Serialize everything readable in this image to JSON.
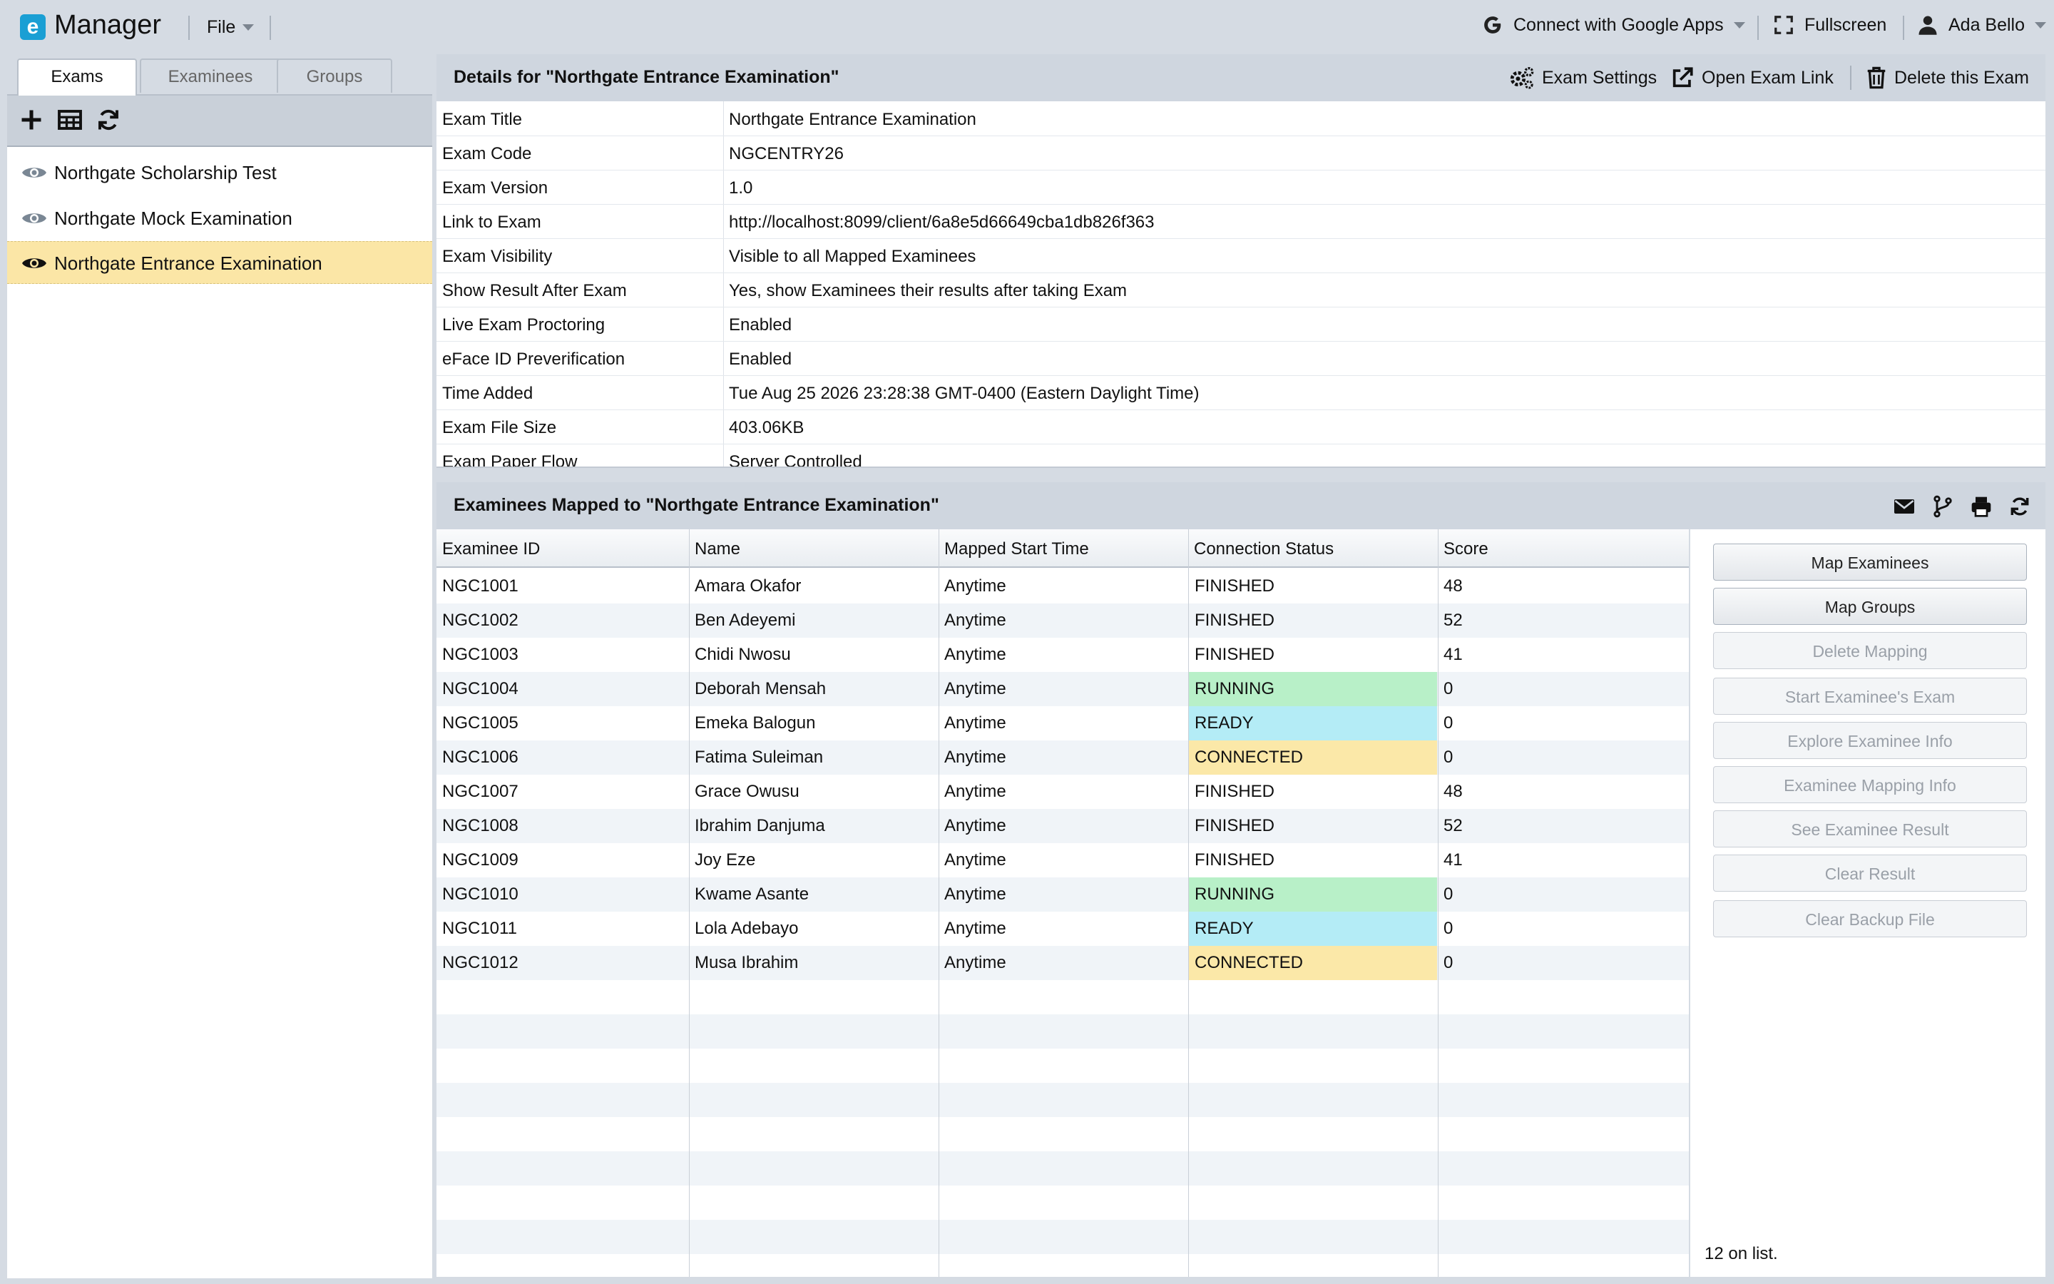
{
  "app": {
    "logo_letter": "e",
    "title": "Manager",
    "file_menu": "File"
  },
  "topbar": {
    "google": "Connect with Google Apps",
    "fullscreen": "Fullscreen",
    "user": "Ada Bello"
  },
  "left": {
    "tabs": [
      "Exams",
      "Examinees",
      "Groups"
    ],
    "active_tab": "Exams",
    "exams": [
      {
        "name": "Northgate Scholarship Test",
        "selected": false
      },
      {
        "name": "Northgate Mock Examination",
        "selected": false
      },
      {
        "name": "Northgate Entrance Examination",
        "selected": true
      }
    ]
  },
  "details": {
    "title": "Details for \"Northgate Entrance Examination\"",
    "actions": {
      "settings": "Exam Settings",
      "open_link": "Open Exam Link",
      "delete": "Delete this Exam"
    },
    "rows": [
      {
        "key": "Exam Title",
        "value": "Northgate Entrance Examination"
      },
      {
        "key": "Exam Code",
        "value": "NGCENTRY26"
      },
      {
        "key": "Exam Version",
        "value": "1.0"
      },
      {
        "key": "Link to Exam",
        "value": "http://localhost:8099/client/6a8e5d66649cba1db826f363"
      },
      {
        "key": "Exam Visibility",
        "value": "Visible to all Mapped Examinees"
      },
      {
        "key": "Show Result After Exam",
        "value": "Yes, show Examinees their results after taking Exam"
      },
      {
        "key": "Live Exam Proctoring",
        "value": "Enabled"
      },
      {
        "key": "eFace ID Preverification",
        "value": "Enabled"
      },
      {
        "key": "Time Added",
        "value": "Tue Aug 25 2026 23:28:38 GMT-0400 (Eastern Daylight Time)"
      },
      {
        "key": "Exam File Size",
        "value": "403.06KB"
      },
      {
        "key": "Exam Paper Flow",
        "value": "Server Controlled"
      }
    ]
  },
  "examinees": {
    "title": "Examinees Mapped to \"Northgate Entrance Examination\"",
    "columns": [
      "Examinee ID",
      "Name",
      "Mapped Start Time",
      "Connection Status",
      "Score"
    ],
    "rows": [
      {
        "id": "NGC1001",
        "name": "Amara Okafor",
        "start": "Anytime",
        "status": "FINISHED",
        "score": "48"
      },
      {
        "id": "NGC1002",
        "name": "Ben Adeyemi",
        "start": "Anytime",
        "status": "FINISHED",
        "score": "52"
      },
      {
        "id": "NGC1003",
        "name": "Chidi Nwosu",
        "start": "Anytime",
        "status": "FINISHED",
        "score": "41"
      },
      {
        "id": "NGC1004",
        "name": "Deborah Mensah",
        "start": "Anytime",
        "status": "RUNNING",
        "score": "0"
      },
      {
        "id": "NGC1005",
        "name": "Emeka Balogun",
        "start": "Anytime",
        "status": "READY",
        "score": "0"
      },
      {
        "id": "NGC1006",
        "name": "Fatima Suleiman",
        "start": "Anytime",
        "status": "CONNECTED",
        "score": "0"
      },
      {
        "id": "NGC1007",
        "name": "Grace Owusu",
        "start": "Anytime",
        "status": "FINISHED",
        "score": "48"
      },
      {
        "id": "NGC1008",
        "name": "Ibrahim Danjuma",
        "start": "Anytime",
        "status": "FINISHED",
        "score": "52"
      },
      {
        "id": "NGC1009",
        "name": "Joy Eze",
        "start": "Anytime",
        "status": "FINISHED",
        "score": "41"
      },
      {
        "id": "NGC1010",
        "name": "Kwame Asante",
        "start": "Anytime",
        "status": "RUNNING",
        "score": "0"
      },
      {
        "id": "NGC1011",
        "name": "Lola Adebayo",
        "start": "Anytime",
        "status": "READY",
        "score": "0"
      },
      {
        "id": "NGC1012",
        "name": "Musa Ibrahim",
        "start": "Anytime",
        "status": "CONNECTED",
        "score": "0"
      }
    ],
    "actions": [
      {
        "label": "Map Examinees",
        "enabled": true
      },
      {
        "label": "Map Groups",
        "enabled": true
      },
      {
        "label": "Delete Mapping",
        "enabled": false
      },
      {
        "label": "Start Examinee's Exam",
        "enabled": false
      },
      {
        "label": "Explore Examinee Info",
        "enabled": false
      },
      {
        "label": "Examinee Mapping Info",
        "enabled": false
      },
      {
        "label": "See Examinee Result",
        "enabled": false
      },
      {
        "label": "Clear Result",
        "enabled": false
      },
      {
        "label": "Clear Backup File",
        "enabled": false
      }
    ],
    "count_text": "12 on list."
  },
  "colors": {
    "running": "#b8f0c8",
    "ready": "#b4ecf6",
    "connected": "#fbe8a8",
    "selected": "#fbe6a6",
    "brand": "#1a9fd4"
  }
}
